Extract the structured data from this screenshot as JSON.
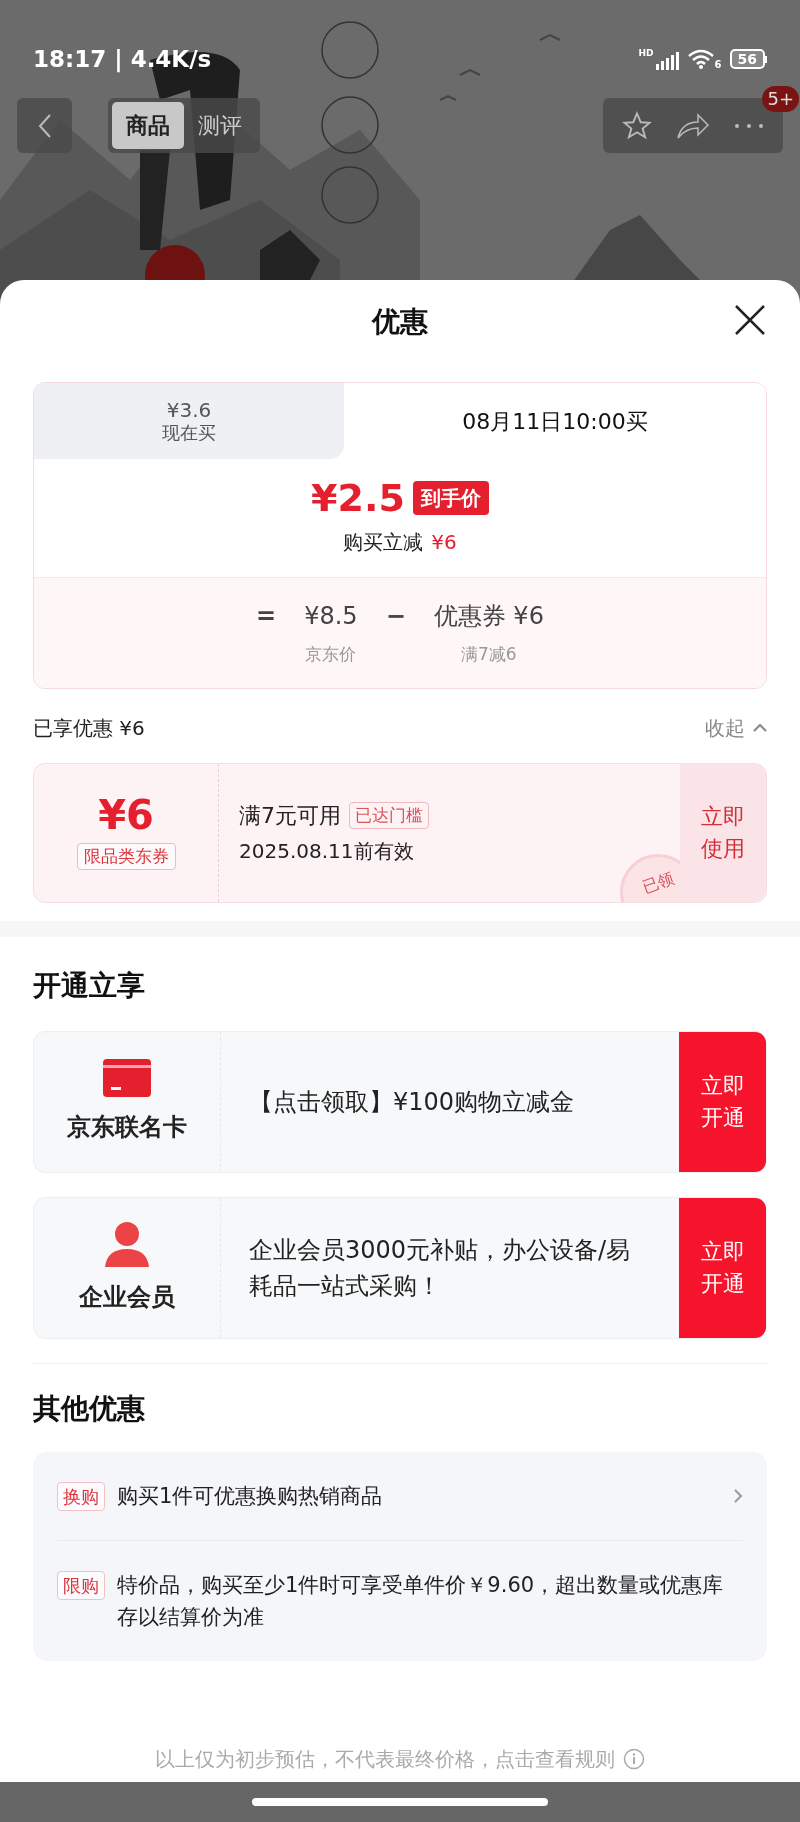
{
  "status_bar": {
    "time": "18:17 | 4.4K/s",
    "signal_label": "HD",
    "wifi_label": "6",
    "battery": "56"
  },
  "nav": {
    "tabs": [
      {
        "label": "商品",
        "selected": true
      },
      {
        "label": "测评",
        "selected": false
      }
    ],
    "more_badge": "5+"
  },
  "sheet": {
    "title": "优惠"
  },
  "price_card": {
    "tabs": [
      {
        "price": "¥3.6",
        "label": "现在买",
        "selected": false
      },
      {
        "label": "08月11日10:00买",
        "selected": true
      }
    ],
    "final_price": "¥2.5",
    "final_badge": "到手价",
    "savings_label": "购买立减",
    "savings_amount": "¥6",
    "formula": [
      {
        "kind": "operator",
        "text": "="
      },
      {
        "kind": "term",
        "text": "¥8.5",
        "caption": "京东价"
      },
      {
        "kind": "operator",
        "text": "−"
      },
      {
        "kind": "term",
        "text": "优惠券 ¥6",
        "caption": "满7减6"
      }
    ]
  },
  "summary": {
    "label": "已享优惠 ¥6",
    "toggle": "收起",
    "expanded": true
  },
  "coupon": {
    "amount": "¥6",
    "tag": "限品类东券",
    "condition": "满7元可用",
    "status": "已达门槛",
    "validity": "2025.08.11前有效",
    "action": "立即使用",
    "stamp": "已领",
    "claimed": true
  },
  "membership": {
    "title": "开通立享",
    "offers": [
      {
        "kind": "card",
        "name": "京东联名卡",
        "text": "【点击领取】¥100购物立减金",
        "action": "立即开通"
      },
      {
        "kind": "member",
        "name": "企业会员",
        "text": "企业会员3000元补贴，办公设备/易耗品一站式采购！",
        "action": "立即开通"
      }
    ]
  },
  "other": {
    "title": "其他优惠",
    "items": [
      {
        "tag": "换购",
        "text": "购买1件可优惠换购热销商品",
        "link": true
      },
      {
        "tag": "限购",
        "text": "特价品，购买至少1件时可享受单件价￥9.60，超出数量或优惠库存以结算价为准",
        "link": false
      }
    ]
  },
  "footer": {
    "text": "以上仅为初步预估，不代表最终价格，点击查看规则"
  }
}
